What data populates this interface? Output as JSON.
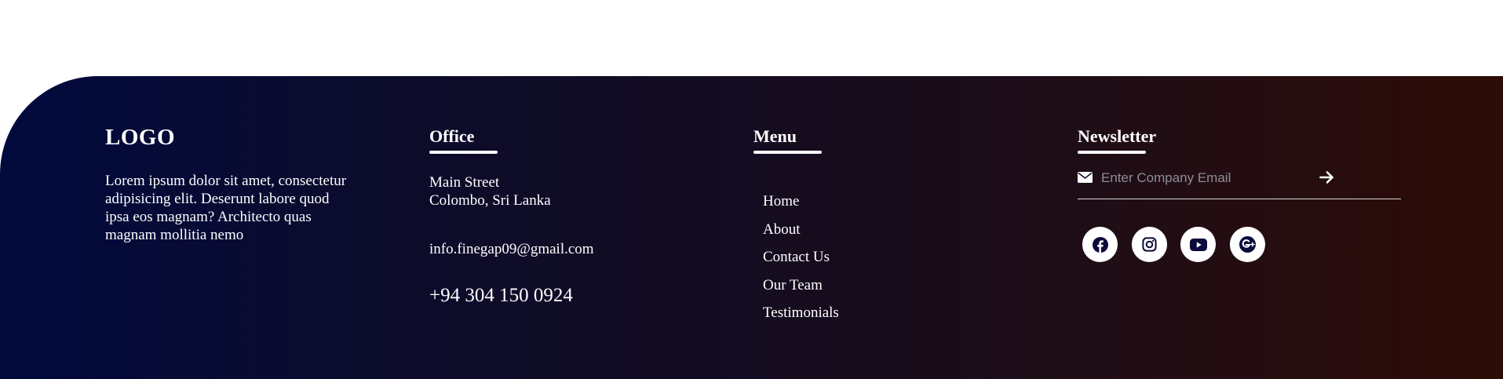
{
  "brand": {
    "logo_text": "LOGO",
    "description": "Lorem ipsum dolor sit amet, consectetur adipisicing elit. Deserunt labore quod ipsa eos magnam? Architecto quas magnam mollitia nemo"
  },
  "office": {
    "heading": "Office",
    "address_line1": "Main Street",
    "address_line2": "Colombo, Sri Lanka",
    "email": "info.finegap09@gmail.com",
    "phone": "+94 304 150 0924"
  },
  "menu": {
    "heading": "Menu",
    "items": [
      {
        "label": "Home"
      },
      {
        "label": "About"
      },
      {
        "label": "Contact Us"
      },
      {
        "label": "Our Team"
      },
      {
        "label": "Testimonials"
      }
    ]
  },
  "newsletter": {
    "heading": "Newsletter",
    "input_placeholder": "Enter Company Email",
    "input_value": "",
    "input_icon": "envelope-icon",
    "submit_icon": "arrow-right-icon"
  },
  "social_links": [
    {
      "network": "facebook",
      "icon": "facebook-icon"
    },
    {
      "network": "instagram",
      "icon": "instagram-icon"
    },
    {
      "network": "youtube",
      "icon": "youtube-icon"
    },
    {
      "network": "google-plus",
      "icon": "google-plus-icon"
    }
  ],
  "colors": {
    "gradient_start": "#010a3d",
    "gradient_end": "#2d0c05",
    "text": "#ffffff",
    "icon_fill": "#0a0b3a",
    "placeholder": "#8d8d99"
  }
}
